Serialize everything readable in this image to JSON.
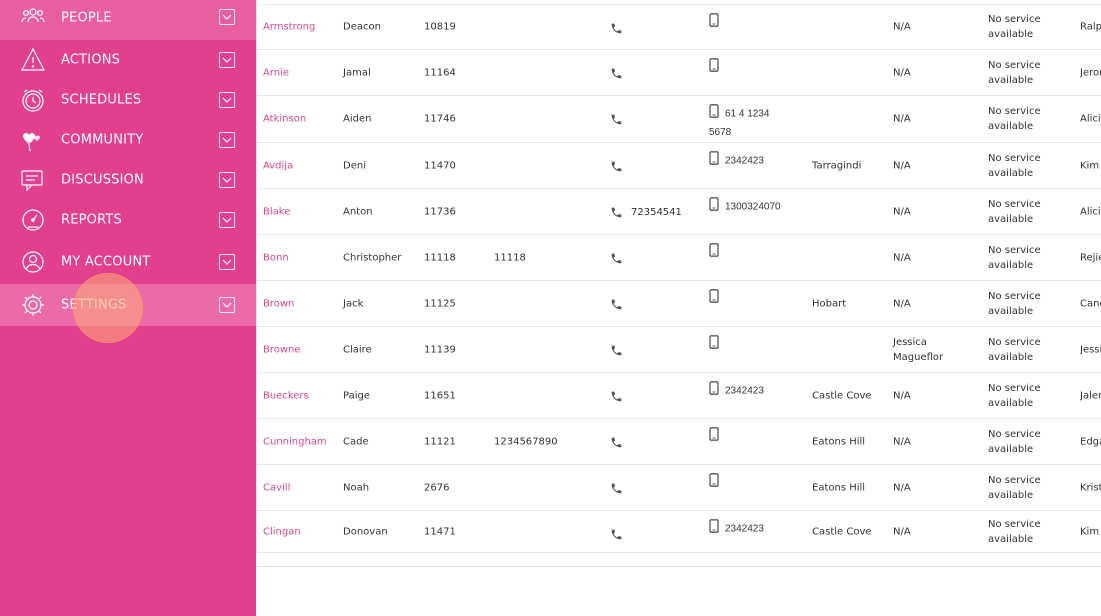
{
  "sidebar": {
    "items": [
      {
        "label": "PEOPLE",
        "icon": "people-icon"
      },
      {
        "label": "ACTIONS",
        "icon": "warning-icon"
      },
      {
        "label": "SCHEDULES",
        "icon": "clock-icon"
      },
      {
        "label": "COMMUNITY",
        "icon": "hearts-icon"
      },
      {
        "label": "DISCUSSION",
        "icon": "chat-icon"
      },
      {
        "label": "REPORTS",
        "icon": "gauge-icon"
      },
      {
        "label": "MY ACCOUNT",
        "icon": "user-icon"
      },
      {
        "label": "SETTINGS",
        "icon": "gear-icon"
      }
    ]
  },
  "table": {
    "rows": [
      {
        "surname": "Armstrong",
        "first": "Deacon",
        "id": "10819",
        "alt": "",
        "phone": "",
        "mobile": "",
        "suburb": "",
        "case": "N/A",
        "service1": "No service",
        "service2": "available",
        "worker": "Ralph"
      },
      {
        "surname": "Arnie",
        "first": "Jamal",
        "id": "11164",
        "alt": "",
        "phone": "",
        "mobile": "",
        "suburb": "",
        "case": "N/A",
        "service1": "No service",
        "service2": "available",
        "worker": "Jerome"
      },
      {
        "surname": "Atkinson",
        "first": "Aiden",
        "id": "11746",
        "alt": "",
        "phone": "",
        "mobile": "61 4 1234",
        "mobile2": "5678",
        "suburb": "",
        "case": "N/A",
        "service1": "No service",
        "service2": "available",
        "worker": "Alicia"
      },
      {
        "surname": "Avdija",
        "first": "Deni",
        "id": "11470",
        "alt": "",
        "phone": "",
        "mobile": "2342423",
        "suburb": "Tarragindi",
        "case": "N/A",
        "service1": "No service",
        "service2": "available",
        "worker": "Kim"
      },
      {
        "surname": "Blake",
        "first": "Anton",
        "id": "11736",
        "alt": "",
        "phone": "72354541",
        "mobile": "1300324070",
        "suburb": "",
        "case": "N/A",
        "service1": "No service",
        "service2": "available",
        "worker": "Alicia"
      },
      {
        "surname": "Bonn",
        "first": "Christopher",
        "id": "11118",
        "alt": "11118",
        "phone": "",
        "mobile": "",
        "suburb": "",
        "case": "N/A",
        "service1": "No service",
        "service2": "available",
        "worker": "Rejie"
      },
      {
        "surname": "Brown",
        "first": "Jack",
        "id": "11125",
        "alt": "",
        "phone": "",
        "mobile": "",
        "suburb": "Hobart",
        "case": "N/A",
        "service1": "No service",
        "service2": "available",
        "worker": "Candy"
      },
      {
        "surname": "Browne",
        "first": "Claire",
        "id": "11139",
        "alt": "",
        "phone": "",
        "mobile": "",
        "suburb": "",
        "case": "Jessica",
        "case2": "Magueflor",
        "service1": "No service",
        "service2": "available",
        "worker": "Jessica"
      },
      {
        "surname": "Bueckers",
        "first": "Paige",
        "id": "11651",
        "alt": "",
        "phone": "",
        "mobile": "2342423",
        "suburb": "Castle Cove",
        "case": "N/A",
        "service1": "No service",
        "service2": "available",
        "worker": "Jalen"
      },
      {
        "surname": "Cunningham",
        "first": "Cade",
        "id": "11121",
        "alt": "1234567890",
        "phone": "",
        "mobile": "",
        "suburb": "Eatons Hill",
        "case": "N/A",
        "service1": "No service",
        "service2": "available",
        "worker": "Edgar"
      },
      {
        "surname": "Cavill",
        "first": "Noah",
        "id": "2676",
        "alt": "",
        "phone": "",
        "mobile": "",
        "suburb": "Eatons Hill",
        "case": "N/A",
        "service1": "No service",
        "service2": "available",
        "worker": "Kristy"
      },
      {
        "surname": "Clingan",
        "first": "Donovan",
        "id": "11471",
        "alt": "",
        "phone": "",
        "mobile": "2342423",
        "suburb": "Castle Cove",
        "case": "N/A",
        "service1": "No service",
        "service2": "available",
        "worker": "Kim"
      }
    ]
  },
  "colors": {
    "sidebar": "#e2408f",
    "link": "#d6498e"
  }
}
